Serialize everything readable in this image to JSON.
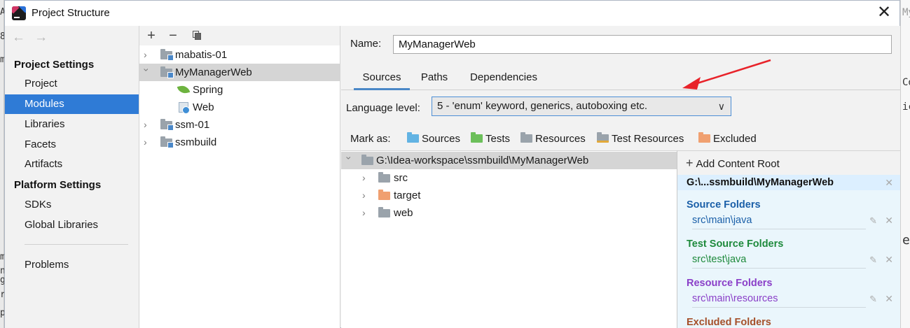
{
  "window": {
    "title": "Project Structure",
    "close_glyph": "✕"
  },
  "background": {
    "left_glyphs": [
      "A",
      "8",
      "m",
      "m",
      "n",
      "g",
      "r",
      "p"
    ],
    "right_texts": [
      "MyM",
      "Cor",
      "ice",
      "el"
    ]
  },
  "nav": {
    "back": "←",
    "forward": "→",
    "project_settings_heading": "Project Settings",
    "project_items": [
      "Project",
      "Modules",
      "Libraries",
      "Facets",
      "Artifacts"
    ],
    "platform_settings_heading": "Platform Settings",
    "platform_items": [
      "SDKs",
      "Global Libraries"
    ],
    "problems": "Problems",
    "selected": "Modules"
  },
  "modules_toolbar": {
    "add": "+",
    "remove": "−"
  },
  "module_tree": {
    "mabatis": "mabatis-01",
    "mymanagerweb": "MyManagerWeb",
    "spring": "Spring",
    "web": "Web",
    "ssm": "ssm-01",
    "ssmbuild": "ssmbuild"
  },
  "detail": {
    "name_label": "Name:",
    "name_value": "MyManagerWeb",
    "tabs": [
      "Sources",
      "Paths",
      "Dependencies"
    ],
    "active_tab": "Sources",
    "language_level_label": "Language level:",
    "language_level_value": "5 - 'enum' keyword, generics, autoboxing etc.",
    "mark_as_label": "Mark as:",
    "mark_buttons": [
      "Sources",
      "Tests",
      "Resources",
      "Test Resources",
      "Excluded"
    ],
    "content_tree": {
      "root": "G:\\Idea-workspace\\ssmbuild\\MyManagerWeb",
      "children": [
        "src",
        "target",
        "web"
      ]
    },
    "content_roots": {
      "add_label": "Add Content Root",
      "root_path": "G:\\...ssmbuild\\MyManagerWeb",
      "source_title": "Source Folders",
      "source_path": "src\\main\\java",
      "test_title": "Test Source Folders",
      "test_path": "src\\test\\java",
      "resource_title": "Resource Folders",
      "resource_path": "src\\main\\resources",
      "excluded_title": "Excluded Folders"
    }
  },
  "colors": {
    "selection": "#2f7bd6",
    "source_blue": "#1a5fa8",
    "test_green": "#1e8a3c",
    "resource_purple": "#8a3fc8",
    "excluded_brown": "#a5502a",
    "annotation_red": "#e8232a"
  }
}
